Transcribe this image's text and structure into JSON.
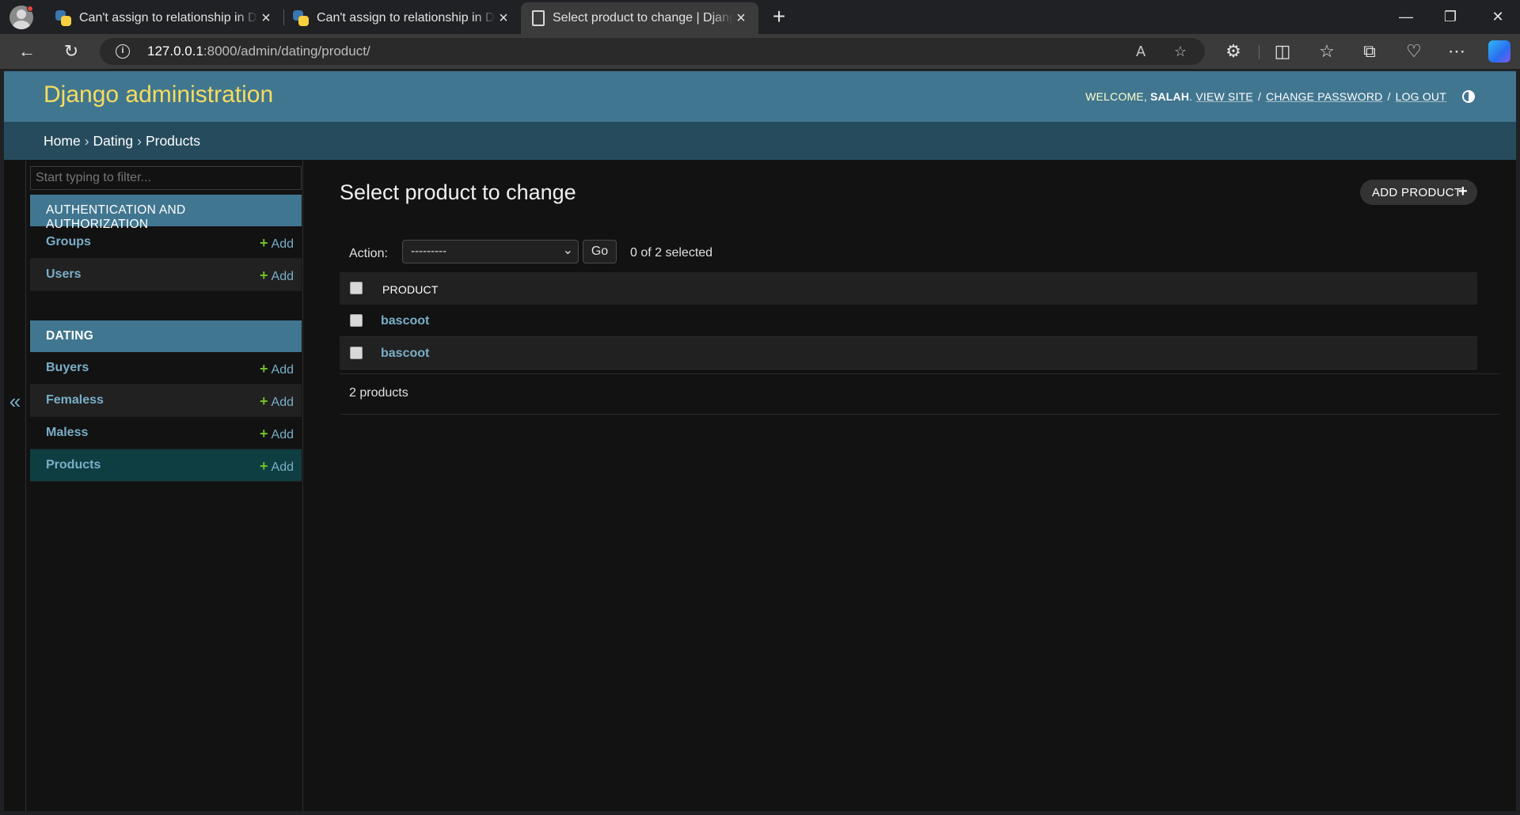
{
  "browser": {
    "tabs": [
      {
        "title": "Can't assign to relationship in Dja",
        "icon": "python-icon"
      },
      {
        "title": "Can't assign to relationship in Dja",
        "icon": "python-icon"
      },
      {
        "title": "Select product to change | Django",
        "icon": "page-icon"
      }
    ],
    "url_host": "127.0.0.1",
    "url_rest": ":8000/admin/dating/product/"
  },
  "admin": {
    "branding": "Django administration",
    "welcome": "WELCOME,",
    "username": "SALAH",
    "view_site": "VIEW SITE",
    "change_password": "CHANGE PASSWORD",
    "log_out": "LOG OUT",
    "sep": "/"
  },
  "breadcrumbs": {
    "home": "Home",
    "app": "Dating",
    "model": "Products",
    "sep": "›"
  },
  "sidebar": {
    "filter_placeholder": "Start typing to filter...",
    "add_label": "Add",
    "modules": [
      {
        "caption": "AUTHENTICATION AND AUTHORIZATION",
        "models": [
          "Groups",
          "Users"
        ]
      },
      {
        "caption": "DATING",
        "models": [
          "Buyers",
          "Femaless",
          "Maless",
          "Products"
        ]
      }
    ],
    "collapse_glyph": "«"
  },
  "content": {
    "title": "Select product to change",
    "add_button": "ADD PRODUCT",
    "action_label": "Action:",
    "action_value": "---------",
    "go_label": "Go",
    "selected_counter": "0 of 2 selected",
    "column_header": "PRODUCT",
    "rows": [
      "bascoot",
      "bascoot"
    ],
    "paginator": "2 products"
  },
  "colors": {
    "header_bg": "#417690",
    "branding": "#f5dd5d",
    "breadcrumbs_bg": "#264b5d",
    "link": "#79aec8",
    "add_plus": "#70bf2b",
    "page_bg": "#121212"
  }
}
